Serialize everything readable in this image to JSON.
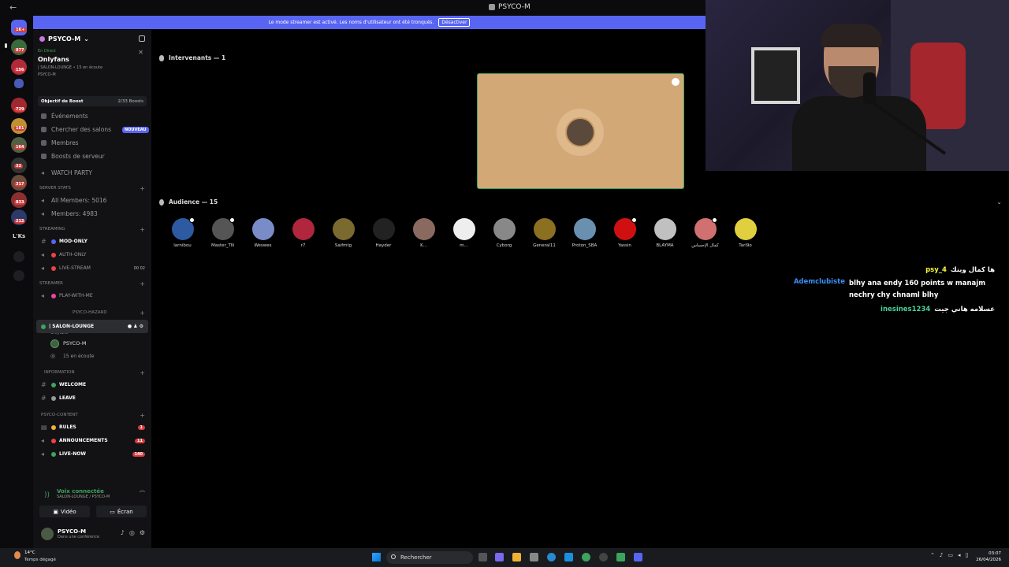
{
  "window": {
    "title": "PSYCO-M",
    "back": "←"
  },
  "banner": {
    "text": "Le mode streamer est activé. Les noms d'utilisateur ont été tronqués.",
    "button": "Désactiver",
    "color": "#5865f2"
  },
  "rail": {
    "badges": [
      "1K+",
      "877",
      "156",
      "729",
      "181",
      "164",
      "32",
      "317",
      "833",
      "212"
    ],
    "label": "L'Ks"
  },
  "sidebar": {
    "server_name": "PSYCO-M",
    "server_chevron": "⌄",
    "live": {
      "status": "En Direct",
      "channel": "Onlyfans",
      "meta": "| SALON-LOUNGE • 15 en écoute",
      "user": "PSYCO-M"
    },
    "boost": {
      "label": "Objectif de Boost",
      "count": "2/33 Boosts"
    },
    "menu": [
      {
        "label": "Événements",
        "icon": "calendar-icon"
      },
      {
        "label": "Chercher des salons",
        "icon": "search-channels-icon",
        "badge": "NOUVEAU"
      },
      {
        "label": "Membres",
        "icon": "members-icon"
      },
      {
        "label": "Boosts de serveur",
        "icon": "boost-icon"
      }
    ],
    "watch_party": "WATCH PARTY",
    "cat_server_stats": "SERVER STATS",
    "stats": [
      "All Members: 5016",
      "Members: 4983"
    ],
    "cat_streaming": "STREAMING",
    "streaming": [
      {
        "label": "MOD-ONLY",
        "color": "#5865f2"
      },
      {
        "label": "AUTH-ONLY",
        "color": "#ed4245"
      },
      {
        "label": "LIVE-STREAM",
        "color": "#ed4245",
        "count": "00 02"
      }
    ],
    "cat_streamer": "STREAMER",
    "streamer": [
      {
        "label": "PLAY-WITH-ME",
        "color": "#eb459e"
      }
    ],
    "cat_hazard": "PSYCO-HAZARD",
    "salon": {
      "label": "| SALON-LOUNGE",
      "sub": "Onlyfans"
    },
    "voice_users": [
      {
        "name": "PSYCO-M"
      },
      {
        "name": "15 en écoute"
      }
    ],
    "cat_information": "INFORMATION",
    "information": [
      {
        "label": "WELCOME"
      },
      {
        "label": "LEAVE"
      }
    ],
    "cat_content": "PSYCO-CONTENT",
    "content": [
      {
        "label": "RULES",
        "count": "1"
      },
      {
        "label": "ANNOUNCEMENTS",
        "count": "11"
      },
      {
        "label": "LIVE-NOW",
        "count": "140"
      }
    ],
    "voice_connected": {
      "title": "Voix connectée",
      "path": "SALON-LOUNGE / PSYCO-M",
      "video": "Vidéo",
      "screen": "Écran"
    },
    "user": {
      "name": "PSYCO-M",
      "status": "Dans une conférence"
    }
  },
  "stage": {
    "speakers_label": "Intervenants — 1",
    "audience_label": "Audience — 15",
    "audience": [
      {
        "name": "larnibou",
        "color": "#2d5aa0",
        "mod": true
      },
      {
        "name": "Master_TN",
        "color": "#555",
        "mod": true
      },
      {
        "name": "Weswes",
        "color": "#7a8cc8",
        "mod": false
      },
      {
        "name": "r7",
        "color": "#b0263c",
        "mod": false
      },
      {
        "name": "Saifmtg",
        "color": "#7a6a30",
        "mod": false
      },
      {
        "name": "Hayder",
        "color": "#222",
        "mod": false
      },
      {
        "name": "K...",
        "color": "#8a6a60",
        "mod": false
      },
      {
        "name": "m...",
        "color": "#eee",
        "mod": false
      },
      {
        "name": "Cyborg",
        "color": "#888",
        "mod": false
      },
      {
        "name": "General11",
        "color": "#8a7020",
        "mod": false
      },
      {
        "name": "Proton_SBA",
        "color": "#6a90b0",
        "mod": false
      },
      {
        "name": "Yassin",
        "color": "#d01010",
        "mod": true
      },
      {
        "name": "BLAYMA",
        "color": "#c0c0c0",
        "mod": false
      },
      {
        "name": "كمال الإحساس",
        "color": "#d07070",
        "mod": true
      },
      {
        "name": "Tari9o",
        "color": "#e0d040",
        "mod": false
      }
    ]
  },
  "chat": [
    {
      "user": "psy_4",
      "text": "ها كمال وينك",
      "color": "#f5f542"
    },
    {
      "user": "Ademclubiste",
      "text": "blhy ana endy 160 points w manajm nechry chy chnaml blhy",
      "color": "#3b8ff5"
    },
    {
      "user": "inesines1234",
      "text": "عسلامه هاني جيت",
      "color": "#46d39a"
    }
  ],
  "taskbar": {
    "temp": "14°C",
    "weather": "Temps dégagé",
    "search": "Rechercher",
    "time": "03:07",
    "date": "26/04/2026"
  }
}
